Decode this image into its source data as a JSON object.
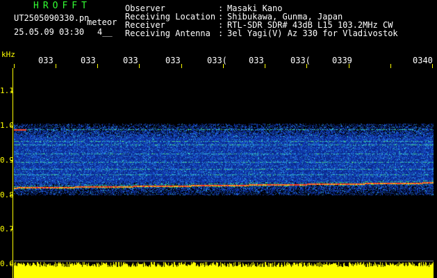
{
  "header": {
    "app_title": "HROFFT",
    "filename": "UT2505090330.pn",
    "detector": "meteor",
    "datetime": "25.05.09 03:30",
    "blip": "4__"
  },
  "info": [
    {
      "label": "Observer",
      "value": "Masaki Kano"
    },
    {
      "label": "Receiving Location",
      "value": "Shibukawa, Gunma, Japan"
    },
    {
      "label": "Receiver",
      "value": "RTL-SDR SDR# 43dB L15 103.2MHz CW"
    },
    {
      "label": "Receiving Antenna",
      "value": "3el Yagi(V) Az 330 for Vladivostok"
    }
  ],
  "info_colon": ":",
  "axis": {
    "y_unit": "kHz",
    "y_ticks": [
      "1.1",
      "1.0",
      "0.9",
      "0.8",
      "0.7",
      "0.6"
    ],
    "x_ticks": [
      "033",
      "033",
      "033",
      "033",
      "033(",
      "033",
      "033(",
      "0339",
      "0340"
    ]
  },
  "colors": {
    "background": "#000000",
    "axis": "#ffff00",
    "title": "#33ff33",
    "text": "#ffffff",
    "band_base": "#0a2a9a",
    "strong_line": "#ff3b1f",
    "amplitude": "#ffff00"
  },
  "spectrogram": {
    "band_top_khz": 1.005,
    "band_bottom_khz": 0.8,
    "strong_line_khz": 0.822,
    "y_range_khz": [
      0.6,
      1.16
    ]
  }
}
